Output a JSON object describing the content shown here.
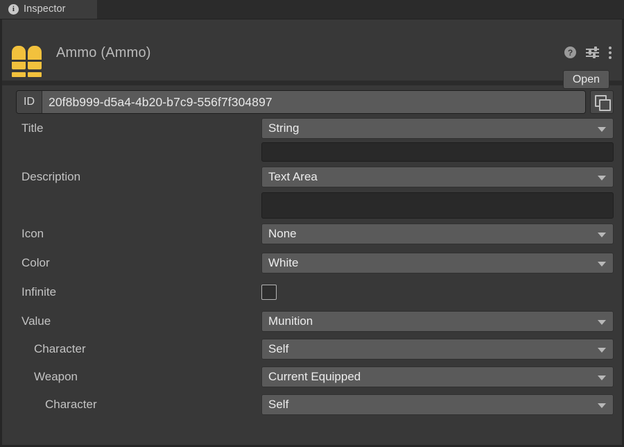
{
  "window": {
    "tab_label": "Inspector",
    "tab_icon": "info-icon"
  },
  "header": {
    "title": "Ammo (Ammo)",
    "icon": "ammo-bullets-icon",
    "help_icon": "help-icon",
    "settings_icon": "settings-sliders-icon",
    "menu_icon": "kebab-menu-icon",
    "open_label": "Open"
  },
  "id_row": {
    "tag": "ID",
    "value": "20f8b999-d5a4-4b20-b7c9-556f7f304897",
    "copy_icon": "copy-icon"
  },
  "fields": {
    "title": {
      "label": "Title",
      "value": "String",
      "text_value": ""
    },
    "description": {
      "label": "Description",
      "value": "Text Area",
      "text_value": ""
    },
    "icon": {
      "label": "Icon",
      "value": "None"
    },
    "color": {
      "label": "Color",
      "value": "White"
    },
    "infinite": {
      "label": "Infinite",
      "checked": "false"
    },
    "value": {
      "label": "Value",
      "value": "Munition"
    },
    "value_character": {
      "label": "Character",
      "value": "Self"
    },
    "value_weapon": {
      "label": "Weapon",
      "value": "Current Equipped"
    },
    "weapon_character": {
      "label": "Character",
      "value": "Self"
    }
  },
  "colors": {
    "accent_yellow": "#f2c13d",
    "panel": "#383838",
    "control": "#5a5a5a",
    "background": "#2b2b2b"
  }
}
